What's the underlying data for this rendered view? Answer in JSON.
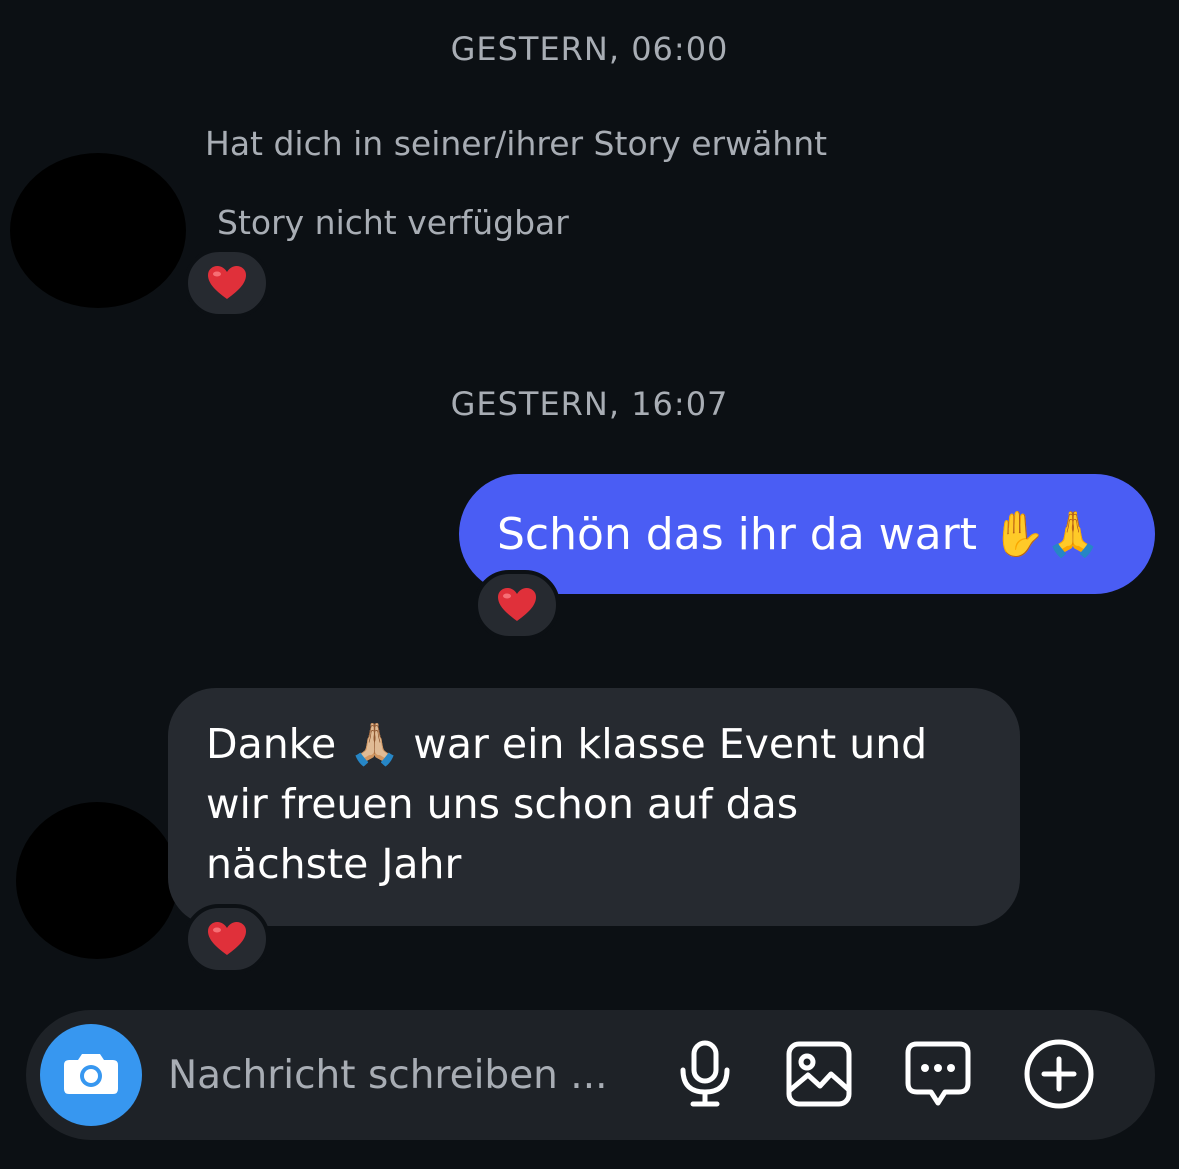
{
  "thread": {
    "timestamp_1": "GESTERN, 06:00",
    "story_mention_label": "Hat dich in seiner/ihrer Story erwähnt",
    "story_unavailable_label": "Story nicht verfügbar",
    "timestamp_2": "GESTERN, 16:07",
    "outgoing_message": "Schön das ihr da wart ✋🙏",
    "incoming_message_line1": "Danke 🙏🏼 war ein klasse Event und",
    "incoming_message_line2": "wir freuen uns schon auf das",
    "incoming_message_line3": "nächste Jahr"
  },
  "reactions": {
    "story_reaction": "heart-icon",
    "outgoing_reaction": "heart-icon",
    "incoming_reaction": "heart-icon"
  },
  "composer": {
    "placeholder": "Nachricht schreiben ...",
    "camera_icon": "camera-icon",
    "mic_icon": "microphone-icon",
    "gallery_icon": "image-icon",
    "sticker_icon": "chat-bubble-icon",
    "add_icon": "plus-circle-icon"
  },
  "colors": {
    "background": "#0c1014",
    "outgoing_bubble": "#4a5df4",
    "incoming_bubble": "#262a30",
    "camera_button": "#3797f0",
    "heart": "#e0303a"
  }
}
